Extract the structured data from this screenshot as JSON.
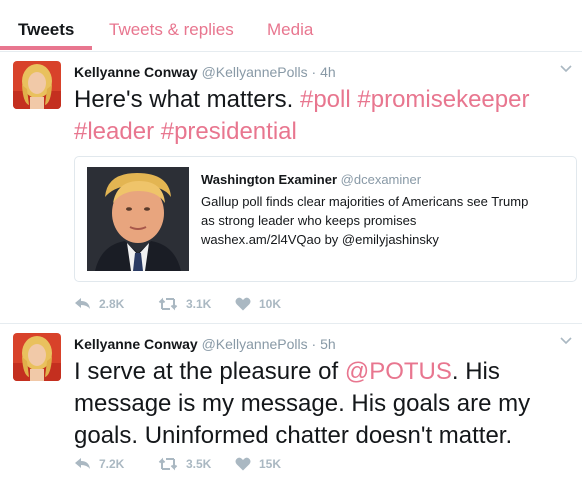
{
  "tabs": [
    {
      "label": "Tweets",
      "active": true
    },
    {
      "label": "Tweets & replies",
      "active": false
    },
    {
      "label": "Media",
      "active": false
    }
  ],
  "colors": {
    "accent": "#e8768f",
    "muted": "#8899a6",
    "text": "#14171a",
    "border": "#e6ecf0"
  },
  "tweets": [
    {
      "name": "Kellyanne Conway",
      "handle": "@KellyannePolls",
      "time": "· 4h",
      "text_parts": [
        "Here's what matters. ",
        "#poll",
        " ",
        "#promisekeeper",
        " ",
        "#leader",
        " ",
        "#presidential"
      ],
      "card": {
        "source": "Washington Examiner",
        "handle": "@dcexaminer",
        "line1": "Gallup poll finds clear majorities of Americans see Trump",
        "line2": "as strong leader who keeps promises",
        "line3": "washex.am/2l4VQao by @emilyjashinsky"
      },
      "replies": "2.8K",
      "retweets": "3.1K",
      "likes": "10K"
    },
    {
      "name": "Kellyanne Conway",
      "handle": "@KellyannePolls",
      "time": "· 5h",
      "text_parts": [
        "I serve at the pleasure of ",
        "@POTUS",
        ". His message is my message. His goals are my goals. Uninformed chatter doesn't matter."
      ],
      "replies": "7.2K",
      "retweets": "3.5K",
      "likes": "15K"
    }
  ]
}
